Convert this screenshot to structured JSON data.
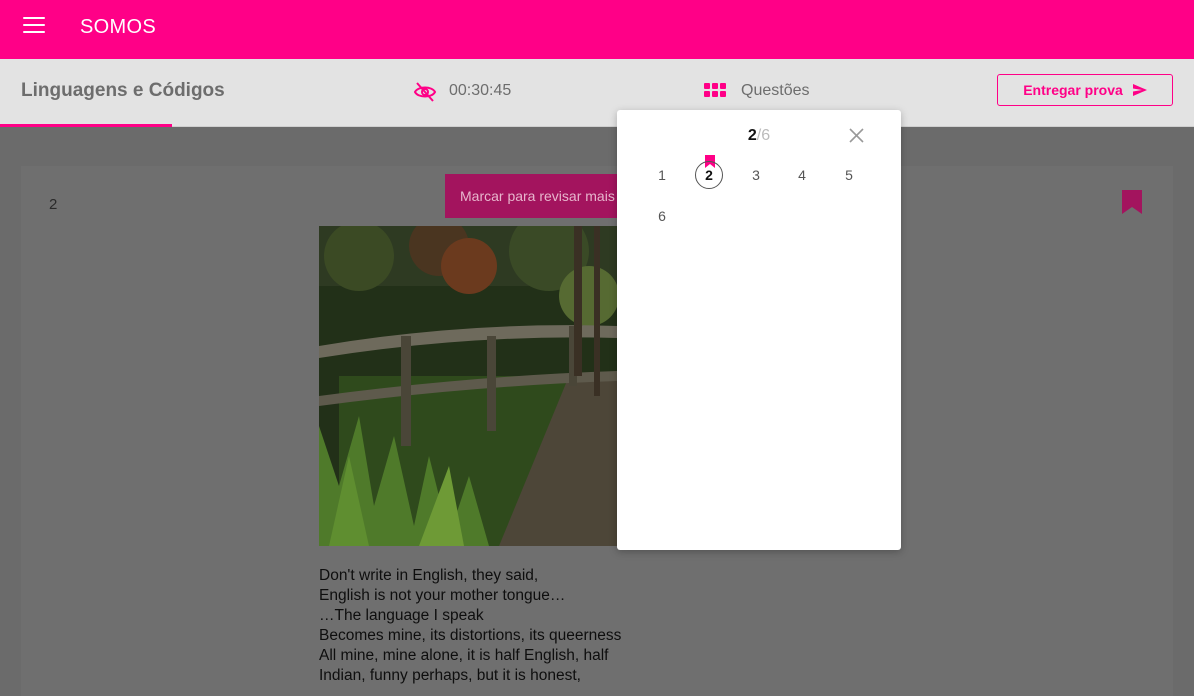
{
  "app": {
    "title": "SOMOS"
  },
  "header": {
    "subject": "Linguagens e Códigos",
    "timer": "00:30:45",
    "questions_label": "Questões",
    "submit_label": "Entregar prova"
  },
  "question": {
    "number": "2",
    "mark_label": "Marcar para revisar mais tarde",
    "poem_lines": [
      "Don't write in English, they said,",
      "English is not your mother tongue…",
      "…The language I speak",
      "Becomes mine, its distortions, its queerness",
      "All mine, mine alone, it is half English, half",
      "Indian, funny perhaps, but it is honest,"
    ]
  },
  "navigator": {
    "current": "2",
    "separator": "/",
    "total": "6",
    "numbers": [
      "1",
      "2",
      "3",
      "4",
      "5",
      "6"
    ],
    "current_index": 1
  },
  "colors": {
    "brand": "#ff0087",
    "mark_button": "#a3145e",
    "overlay": "#6b6b6b"
  },
  "icons": [
    "menu-icon",
    "eye-off-icon",
    "grid-icon",
    "send-icon",
    "bookmark-icon",
    "close-icon"
  ]
}
